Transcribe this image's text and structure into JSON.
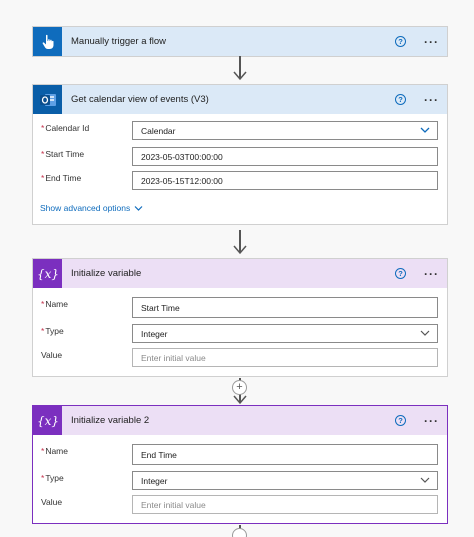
{
  "trigger": {
    "title": "Manually trigger a flow"
  },
  "calendar": {
    "title": "Get calendar view of events (V3)",
    "fields": [
      {
        "label": "Calendar Id",
        "value": "Calendar"
      },
      {
        "label": "Start Time",
        "value": "2023-05-03T00:00:00"
      },
      {
        "label": "End Time",
        "value": "2023-05-15T12:00:00"
      }
    ],
    "show_advanced": "Show advanced options"
  },
  "init1": {
    "title": "Initialize variable",
    "fields": [
      {
        "label": "Name",
        "value": "Start Time"
      },
      {
        "label": "Type",
        "value": "Integer"
      },
      {
        "label": "Value",
        "placeholder": "Enter initial value"
      }
    ]
  },
  "init2": {
    "title": "Initialize variable 2",
    "fields": [
      {
        "label": "Name",
        "value": "End Time"
      },
      {
        "label": "Type",
        "value": "Integer"
      },
      {
        "label": "Value",
        "placeholder": "Enter initial value"
      }
    ]
  },
  "common": {
    "help": "?",
    "more": "···",
    "req": "*",
    "plus": "+"
  },
  "colors": {
    "accent_blue": "#0f6cbd",
    "variable_purple": "#7b2fbf",
    "trigger_header": "#dbe9f7",
    "variable_header": "#ecdff5"
  },
  "icons": {
    "trigger": "hand-pointer-icon",
    "calendar": "outlook-icon",
    "variable": "variable-x-icon"
  }
}
